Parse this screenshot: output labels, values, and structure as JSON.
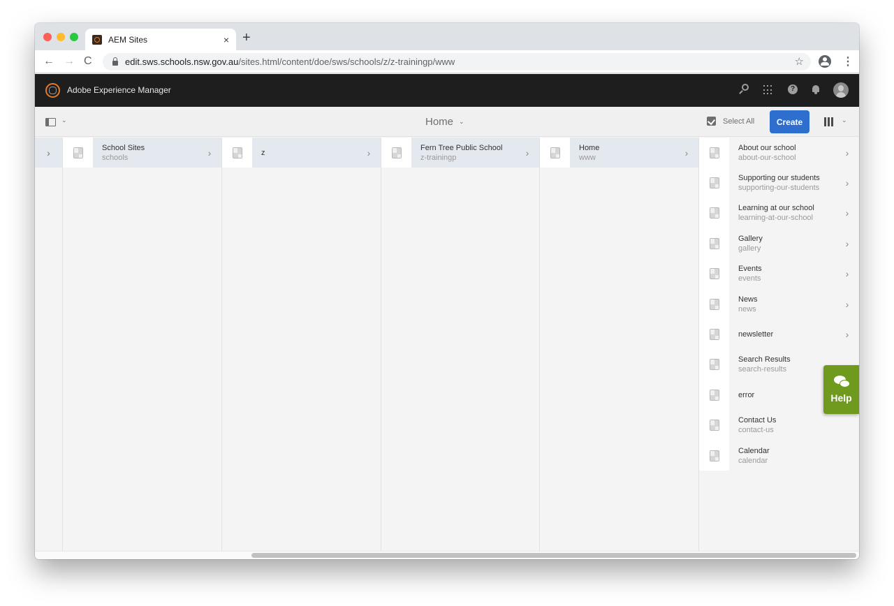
{
  "browser": {
    "tab": {
      "title": "AEM Sites",
      "close_icon": "×"
    },
    "new_tab_icon": "+",
    "nav": {
      "back_icon": "←",
      "forward_icon": "→",
      "reload_icon": "C"
    },
    "url_host": "edit.sws.schools.nsw.gov.au",
    "url_path": "/sites.html/content/doe/sws/schools/z/z-trainingp/www",
    "star_icon": "☆",
    "menu_icon": "⋮"
  },
  "header": {
    "product_name": "Adobe Experience Manager",
    "help_glyph": "?"
  },
  "actionbar": {
    "title": "Home",
    "title_chevron": "⌄",
    "select_all_label": "Select All",
    "create_label": "Create",
    "chevron": "⌄",
    "accent_color": "#2d6ecf"
  },
  "columns": [
    {
      "items": [
        {
          "title": "School Sites",
          "name": "schools",
          "has_children": true,
          "selected": true
        }
      ]
    },
    {
      "items": [
        {
          "title": "z",
          "name": "",
          "has_children": true,
          "selected": true
        }
      ]
    },
    {
      "items": [
        {
          "title": "Fern Tree Public School",
          "name": "z-trainingp",
          "has_children": true,
          "selected": true
        }
      ]
    },
    {
      "items": [
        {
          "title": "Home",
          "name": "www",
          "has_children": true,
          "selected": true
        }
      ]
    },
    {
      "items": [
        {
          "title": "About our school",
          "name": "about-our-school",
          "has_children": true
        },
        {
          "title": "Supporting our students",
          "name": "supporting-our-students",
          "has_children": true
        },
        {
          "title": "Learning at our school",
          "name": "learning-at-our-school",
          "has_children": true
        },
        {
          "title": "Gallery",
          "name": "gallery",
          "has_children": true
        },
        {
          "title": "Events",
          "name": "events",
          "has_children": true
        },
        {
          "title": "News",
          "name": "news",
          "has_children": true
        },
        {
          "title": "newsletter",
          "name": "",
          "has_children": true
        },
        {
          "title": "Search Results",
          "name": "search-results",
          "has_children": false
        },
        {
          "title": "error",
          "name": "",
          "has_children": false
        },
        {
          "title": "Contact Us",
          "name": "contact-us",
          "has_children": false
        },
        {
          "title": "Calendar",
          "name": "calendar",
          "has_children": false
        }
      ]
    }
  ],
  "chevron_right": "›",
  "help_widget": {
    "label": "Help",
    "color": "#6f9a1d"
  }
}
